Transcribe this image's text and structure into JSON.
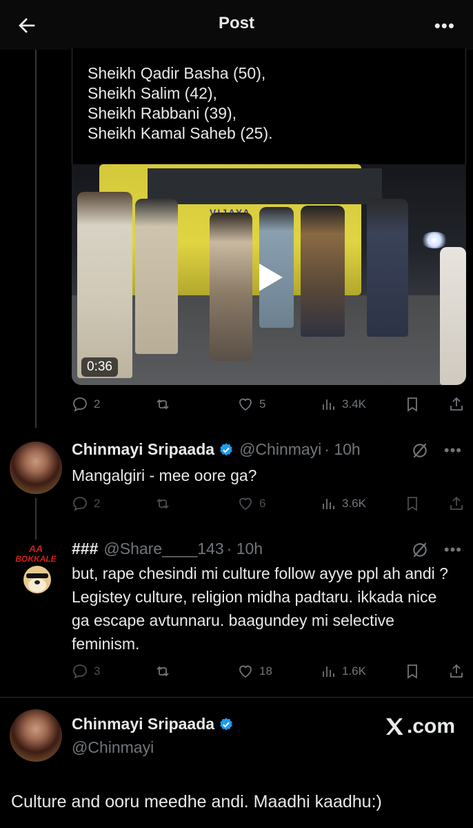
{
  "header": {
    "title": "Post",
    "more": "•••"
  },
  "quoted_tweet": {
    "lines": [
      "Sheikh Qadir Basha (50),",
      "Sheikh Salim (42),",
      "Sheikh Rabbani (39),",
      "Sheikh Kamal Saheb (25)."
    ],
    "video": {
      "duration": "0:36",
      "bus_text": "VIJAYA"
    }
  },
  "tweet1_actions": {
    "replies": "2",
    "retweets": "",
    "likes": "5",
    "views": "3.4K"
  },
  "tweet2": {
    "author": "Chinmayi Sripaada",
    "handle": "@Chinmayi",
    "time": "· 10h",
    "text": "Mangalgiri - mee oore ga?",
    "actions": {
      "replies": "2",
      "retweets": "",
      "likes": "6",
      "views": "3.6K"
    }
  },
  "tweet3": {
    "author": "###",
    "handle": "@Share____143",
    "time": "· 10h",
    "text": "but, rape chesindi mi culture follow ayye ppl ah andi ? Legistey culture, religion midha padtaru. ikkada nice ga escape avtunnaru. baagundey mi selective feminism.",
    "avatar_text_top": "AA",
    "avatar_text_bottom": "BOKKALE",
    "actions": {
      "replies": "3",
      "retweets": "",
      "likes": "18",
      "views": "1.6K"
    }
  },
  "main_tweet": {
    "author": "Chinmayi Sripaada",
    "handle": "@Chinmayi",
    "brand": ".com",
    "text": "Culture and ooru meedhe andi. Maadhi kaadhu:)"
  },
  "colors": {
    "background": "#000000",
    "text": "#e7e9ea",
    "muted": "#71767b",
    "verified": "#1d9bf0"
  }
}
